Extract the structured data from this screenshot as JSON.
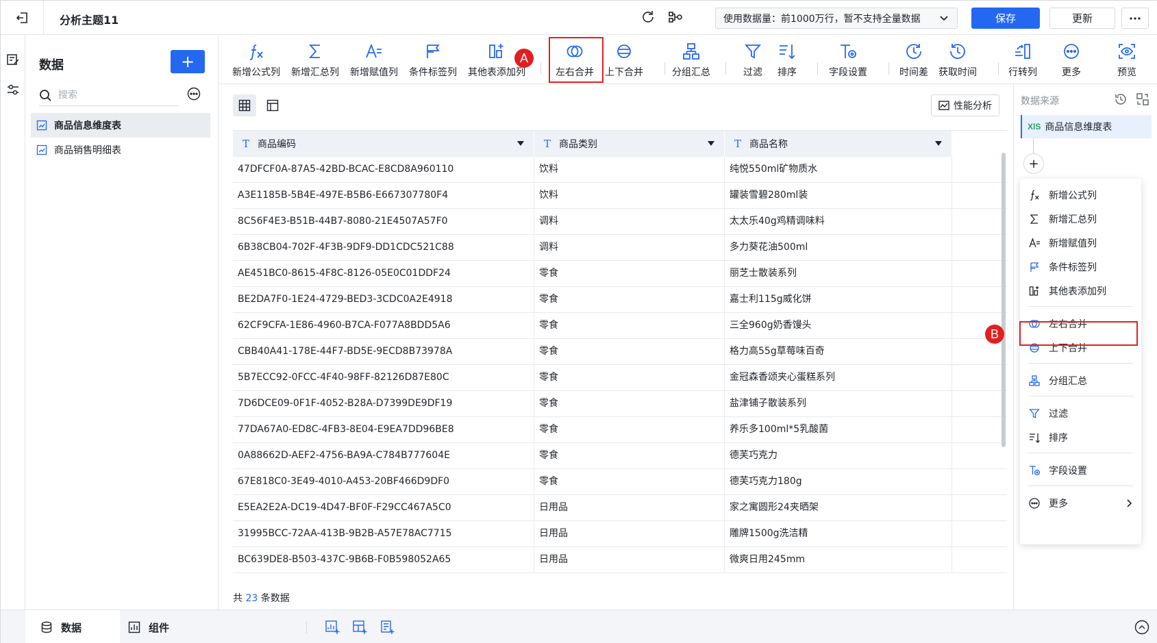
{
  "header": {
    "title": "分析主题11",
    "usage_text": "使用数据量：前1000万行，暂不支持全量数据",
    "save_label": "保存",
    "update_label": "更新"
  },
  "data_panel": {
    "title": "数据",
    "add_label": "+",
    "search_placeholder": "搜索",
    "tables": [
      {
        "label": "商品信息维度表",
        "active": true
      },
      {
        "label": "商品销售明细表",
        "active": false
      }
    ]
  },
  "toolbar": {
    "items": [
      {
        "label": "新增公式列",
        "icon": "formula-icon"
      },
      {
        "label": "新增汇总列",
        "icon": "sigma-icon"
      },
      {
        "label": "新增赋值列",
        "icon": "assign-icon"
      },
      {
        "label": "条件标签列",
        "icon": "condition-tag-icon"
      },
      {
        "label": "其他表添加列",
        "icon": "other-table-add-column-icon"
      },
      {
        "label": "左右合并",
        "icon": "left-right-merge-icon"
      },
      {
        "label": "上下合并",
        "icon": "up-down-merge-icon"
      },
      {
        "label": "分组汇总",
        "icon": "group-summary-icon"
      },
      {
        "label": "过滤",
        "icon": "filter-icon"
      },
      {
        "label": "排序",
        "icon": "sort-icon"
      },
      {
        "label": "字段设置",
        "icon": "field-settings-icon"
      },
      {
        "label": "时间差",
        "icon": "time-diff-icon"
      },
      {
        "label": "获取时间",
        "icon": "get-time-icon"
      },
      {
        "label": "行转列",
        "icon": "row-to-column-icon"
      },
      {
        "label": "更多",
        "icon": "more-icon"
      },
      {
        "label": "预览",
        "icon": "preview-icon"
      }
    ],
    "callout_a": "A"
  },
  "main": {
    "perf_label": "性能分析",
    "columns": [
      "商品编码",
      "商品类别",
      "商品名称"
    ],
    "rows": [
      [
        "47DFCF0A-87A5-42BD-BCAC-E8CD8A960110",
        "饮料",
        "纯悦550ml矿物质水"
      ],
      [
        "A3E1185B-5B4E-497E-B5B6-E667307780F4",
        "饮料",
        "罐装雪碧280ml装"
      ],
      [
        "8C56F4E3-B51B-44B7-8080-21E4507A57F0",
        "调料",
        "太太乐40g鸡精调味料"
      ],
      [
        "6B38CB04-702F-4F3B-9DF9-DD1CDC521C88",
        "调料",
        "多力葵花油500ml"
      ],
      [
        "AE451BC0-8615-4F8C-8126-05E0C01DDF24",
        "零食",
        "丽芝士散装系列"
      ],
      [
        "BE2DA7F0-1E24-4729-BED3-3CDC0A2E4918",
        "零食",
        "嘉士利115g威化饼"
      ],
      [
        "62CF9CFA-1E86-4960-B7CA-F077A8BDD5A6",
        "零食",
        "三全960g奶香馒头"
      ],
      [
        "CBB40A41-178E-44F7-BD5E-9ECD8B73978A",
        "零食",
        "格力高55g草莓味百奇"
      ],
      [
        "5B7ECC92-0FCC-4F40-98FF-82126D87E80C",
        "零食",
        "金冠森香颂夹心蛋糕系列"
      ],
      [
        "7D6DCE09-0F1F-4052-B28A-D7399DE9DF19",
        "零食",
        "盐津铺子散装系列"
      ],
      [
        "77DA67A0-ED8C-4FB3-8E04-E9EA7DD96BE8",
        "零食",
        "养乐多100ml*5乳酸菌"
      ],
      [
        "0A88662D-AEF2-4756-BA9A-C784B777604E",
        "零食",
        "德芙巧克力"
      ],
      [
        "67E818C0-3E49-4010-A453-20BF466D9DF0",
        "零食",
        "德芙巧克力180g"
      ],
      [
        "E5EA2E2A-DC19-4D47-BF0F-F29CC467A5C0",
        "日用品",
        "家之寓圆形24夹晒架"
      ],
      [
        "31995BCC-72AA-413B-9B2B-A57E78AC7715",
        "日用品",
        "雕牌1500g洗洁精"
      ],
      [
        "BC639DE8-B503-437C-9B6B-F0B598052A65",
        "日用品",
        "微爽日用245mm"
      ]
    ],
    "count_prefix": "共 ",
    "count_value": "23",
    "count_suffix": " 条数据"
  },
  "right_panel": {
    "title": "数据来源",
    "source_tag": "XlS",
    "source_label": "商品信息维度表",
    "plus_label": "+",
    "menu": [
      {
        "label": "新增公式列",
        "icon": "formula-icon"
      },
      {
        "label": "新增汇总列",
        "icon": "sigma-icon"
      },
      {
        "label": "新增赋值列",
        "icon": "assign-icon"
      },
      {
        "label": "条件标签列",
        "icon": "condition-tag-icon"
      },
      {
        "label": "其他表添加列",
        "icon": "other-table-add-column-icon"
      },
      {
        "label": "左右合并",
        "icon": "left-right-merge-icon"
      },
      {
        "label": "上下合并",
        "icon": "up-down-merge-icon"
      },
      {
        "label": "分组汇总",
        "icon": "group-summary-icon"
      },
      {
        "label": "过滤",
        "icon": "filter-icon"
      },
      {
        "label": "排序",
        "icon": "sort-icon"
      },
      {
        "label": "字段设置",
        "icon": "field-settings-icon"
      },
      {
        "label": "更多",
        "icon": "more-icon"
      }
    ],
    "callout_b": "B"
  },
  "bottom": {
    "tab_data": "数据",
    "tab_components": "组件"
  },
  "colors": {
    "accent": "#2468f2",
    "highlight": "#e02020",
    "excel_green": "#21a366"
  }
}
